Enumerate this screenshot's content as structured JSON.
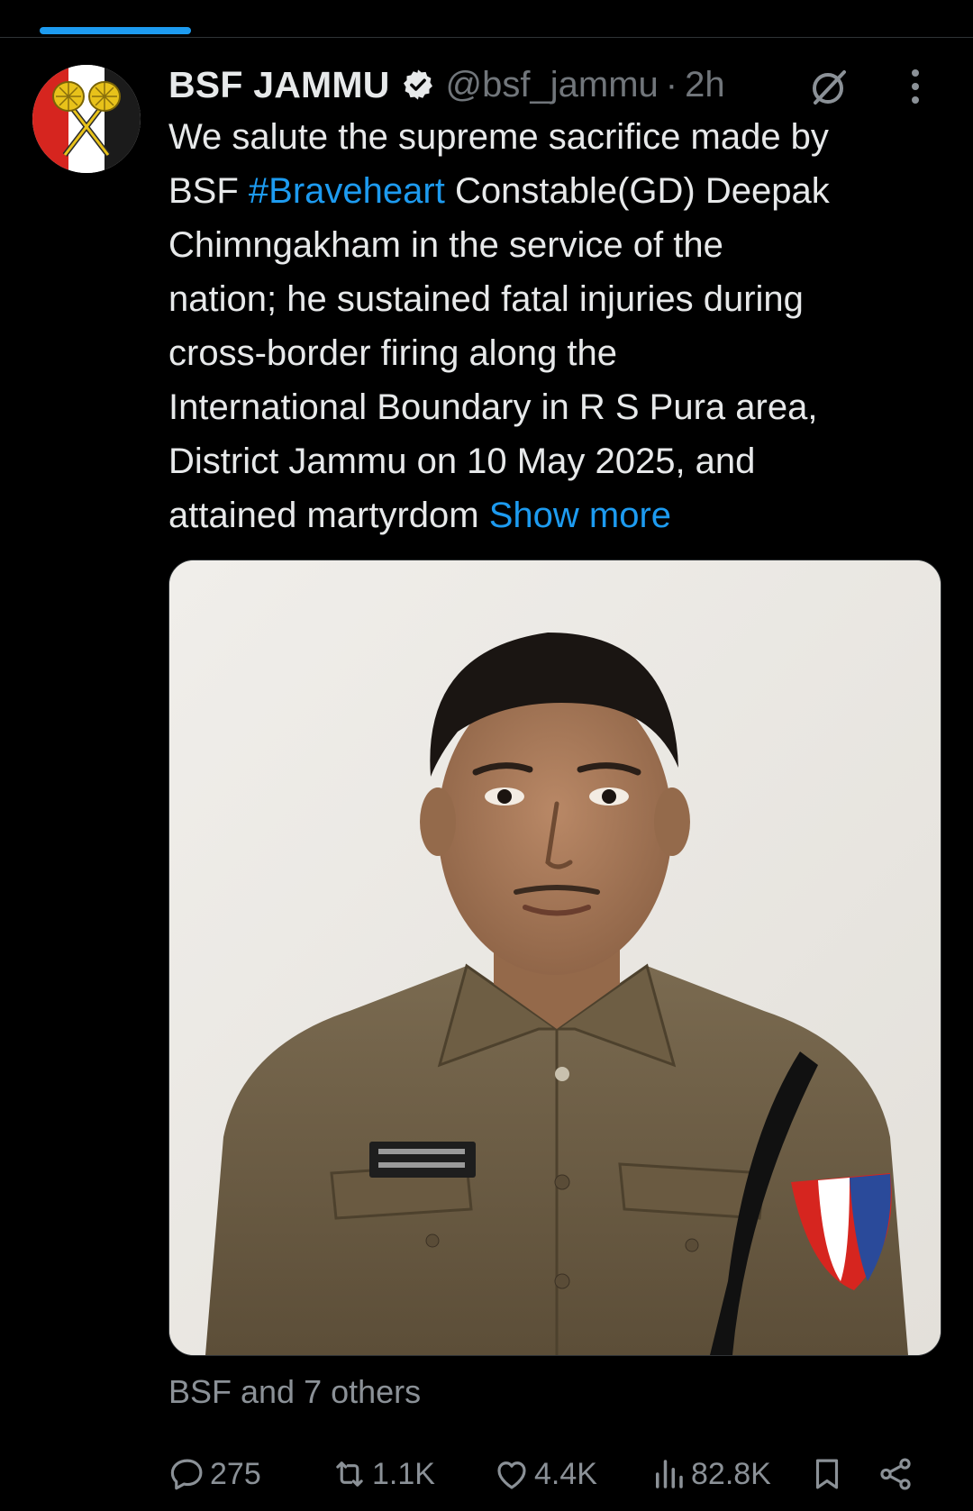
{
  "post": {
    "display_name": "BSF JAMMU",
    "handle": "@bsf_jammu",
    "separator": "·",
    "time": "2h",
    "text_lines": [
      "We salute the supreme sacrifice made by",
      "Constable(GD) Deepak",
      "Chimngakham in the service of the",
      "nation; he sustained fatal injuries during",
      "cross-border firing along the",
      "International Boundary in R S Pura area,",
      "District Jammu on 10 May 2025, and",
      "attained martyrdom"
    ],
    "line2_prefix": "BSF",
    "hashtag": "#Braveheart",
    "show_more": "Show more",
    "liked_by": "BSF and 7 others"
  },
  "actions": {
    "replies": "275",
    "reposts": "1.1K",
    "likes": "4.4K",
    "views": "82.8K"
  },
  "colors": {
    "background": "#000000",
    "text": "#e7e9ea",
    "secondary": "#71767b",
    "accent": "#1d9bf0"
  },
  "icons": {
    "verified": "verified-badge-icon",
    "grok": "grok-icon",
    "more": "more-options-icon",
    "reply": "reply-icon",
    "repost": "repost-icon",
    "like": "like-icon",
    "views": "views-icon",
    "bookmark": "bookmark-icon",
    "share": "share-icon"
  }
}
